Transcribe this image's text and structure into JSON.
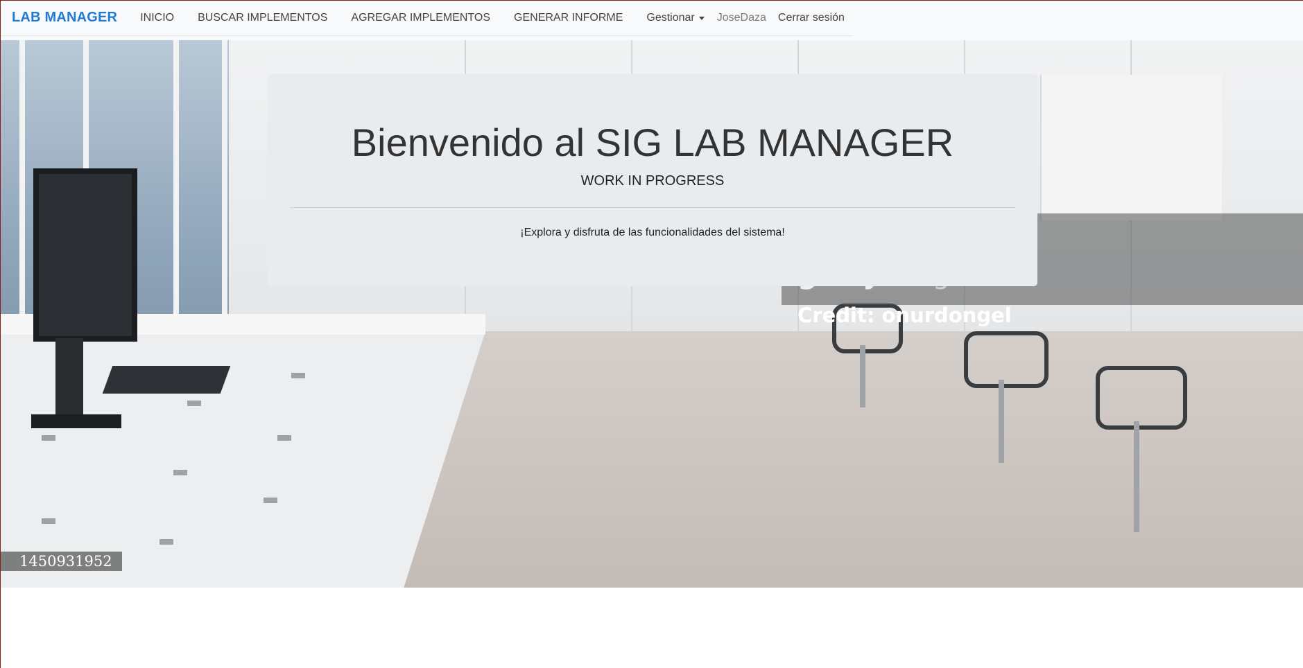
{
  "navbar": {
    "brand": "LAB MANAGER",
    "links": [
      {
        "label": "INICIO"
      },
      {
        "label": "BUSCAR IMPLEMENTOS"
      },
      {
        "label": "AGREGAR IMPLEMENTOS"
      },
      {
        "label": "GENERAR INFORME"
      }
    ],
    "dropdown_label": "Gestionar",
    "username": "JoseDaza",
    "logout_label": "Cerrar sesión"
  },
  "hero": {
    "watermark_logo_bold": "getty",
    "watermark_logo_light": "images",
    "watermark_credit": "Credit: onurdongel",
    "image_id": "1450931952"
  },
  "jumbotron": {
    "title": "Bienvenido al SIG LAB MANAGER",
    "subtitle": "WORK IN PROGRESS",
    "text": "¡Explora y disfruta de las funcionalidades del sistema!"
  },
  "colors": {
    "brand": "#1f7ad6",
    "navbar_bg": "#f8f9fa",
    "jumbotron_bg": "#e9ecef"
  }
}
